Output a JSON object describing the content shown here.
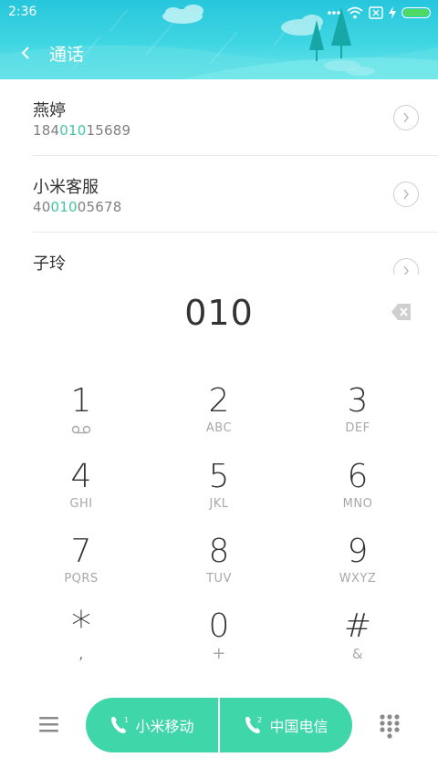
{
  "status_bar": {
    "time": "2:36",
    "icons": [
      "more-dots-icon",
      "wifi-icon",
      "sim-blocked-icon",
      "charging-icon",
      "battery-icon"
    ],
    "battery_color": "#4cd964"
  },
  "header": {
    "title": "通话",
    "back_icon": "chevron-left-icon",
    "background_color": "#27c6dc"
  },
  "results": [
    {
      "name": "燕婷",
      "number_prefix": "184",
      "number_match": "010",
      "number_suffix": "15689"
    },
    {
      "name": "小米客服",
      "number_prefix": "40",
      "number_match": "010",
      "number_suffix": "05678"
    },
    {
      "name": "子玲",
      "number_prefix": "",
      "number_match": "",
      "number_suffix": ""
    }
  ],
  "highlight_color": "#3fc8a0",
  "dial": {
    "number": "010",
    "backspace_icon": "backspace-icon"
  },
  "keypad": [
    {
      "digit": "1",
      "sub": "",
      "sub_icon": "voicemail-icon"
    },
    {
      "digit": "2",
      "sub": "ABC"
    },
    {
      "digit": "3",
      "sub": "DEF"
    },
    {
      "digit": "4",
      "sub": "GHI"
    },
    {
      "digit": "5",
      "sub": "JKL"
    },
    {
      "digit": "6",
      "sub": "MNO"
    },
    {
      "digit": "7",
      "sub": "PQRS"
    },
    {
      "digit": "8",
      "sub": "TUV"
    },
    {
      "digit": "9",
      "sub": "WXYZ"
    },
    {
      "digit": "*",
      "sub": ","
    },
    {
      "digit": "0",
      "sub": "+"
    },
    {
      "digit": "#",
      "sub": "&"
    }
  ],
  "bottom_bar": {
    "menu_icon": "hamburger-menu-icon",
    "call_sim1_label": "小米移动",
    "call_sim1_badge": "1",
    "call_sim2_label": "中国电信",
    "call_sim2_badge": "2",
    "keypad_toggle_icon": "dialpad-icon",
    "accent_color": "#3fd6aa"
  }
}
